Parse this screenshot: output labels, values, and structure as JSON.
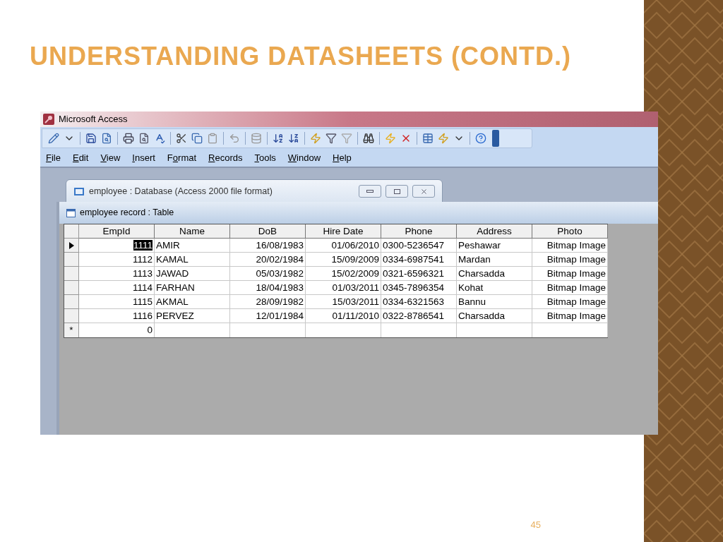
{
  "slide": {
    "title": "UNDERSTANDING DATASHEETS (CONTD.)",
    "page_number": "45"
  },
  "app": {
    "title": "Microsoft Access",
    "menu": [
      {
        "key": "F",
        "after": "ile"
      },
      {
        "key": "E",
        "after": "dit"
      },
      {
        "key": "V",
        "after": "iew"
      },
      {
        "key": "I",
        "after": "nsert"
      },
      {
        "before": "F",
        "key": "o",
        "after": "rmat"
      },
      {
        "key": "R",
        "after": "ecords"
      },
      {
        "key": "T",
        "after": "ools"
      },
      {
        "key": "W",
        "after": "indow"
      },
      {
        "key": "H",
        "after": "elp"
      }
    ]
  },
  "database_window": {
    "title": "employee : Database (Access 2000 file format)"
  },
  "table_window": {
    "title": "employee record : Table",
    "columns": [
      "EmpId",
      "Name",
      "DoB",
      "Hire Date",
      "Phone",
      "Address",
      "Photo"
    ],
    "rows": [
      {
        "current": true,
        "id_selected": true,
        "cells": [
          "1111",
          "AMIR",
          "16/08/1983",
          "01/06/2010",
          "0300-5236547",
          "Peshawar",
          "Bitmap Image"
        ]
      },
      {
        "current": false,
        "id_selected": false,
        "cells": [
          "1112",
          "KAMAL",
          "20/02/1984",
          "15/09/2009",
          "0334-6987541",
          "Mardan",
          "Bitmap Image"
        ]
      },
      {
        "current": false,
        "id_selected": false,
        "cells": [
          "1113",
          "JAWAD",
          "05/03/1982",
          "15/02/2009",
          "0321-6596321",
          "Charsadda",
          "Bitmap Image"
        ]
      },
      {
        "current": false,
        "id_selected": false,
        "cells": [
          "1114",
          "FARHAN",
          "18/04/1983",
          "01/03/2011",
          "0345-7896354",
          "Kohat",
          "Bitmap Image"
        ]
      },
      {
        "current": false,
        "id_selected": false,
        "cells": [
          "1115",
          "AKMAL",
          "28/09/1982",
          "15/03/2011",
          "0334-6321563",
          "Bannu",
          "Bitmap Image"
        ]
      },
      {
        "current": false,
        "id_selected": false,
        "cells": [
          "1116",
          "PERVEZ",
          "12/01/1984",
          "01/11/2010",
          "0322-8786541",
          "Charsadda",
          "Bitmap Image"
        ]
      }
    ],
    "new_row": {
      "marker": "*",
      "cells": [
        "0",
        "",
        "",
        "",
        "",
        "",
        ""
      ]
    }
  }
}
